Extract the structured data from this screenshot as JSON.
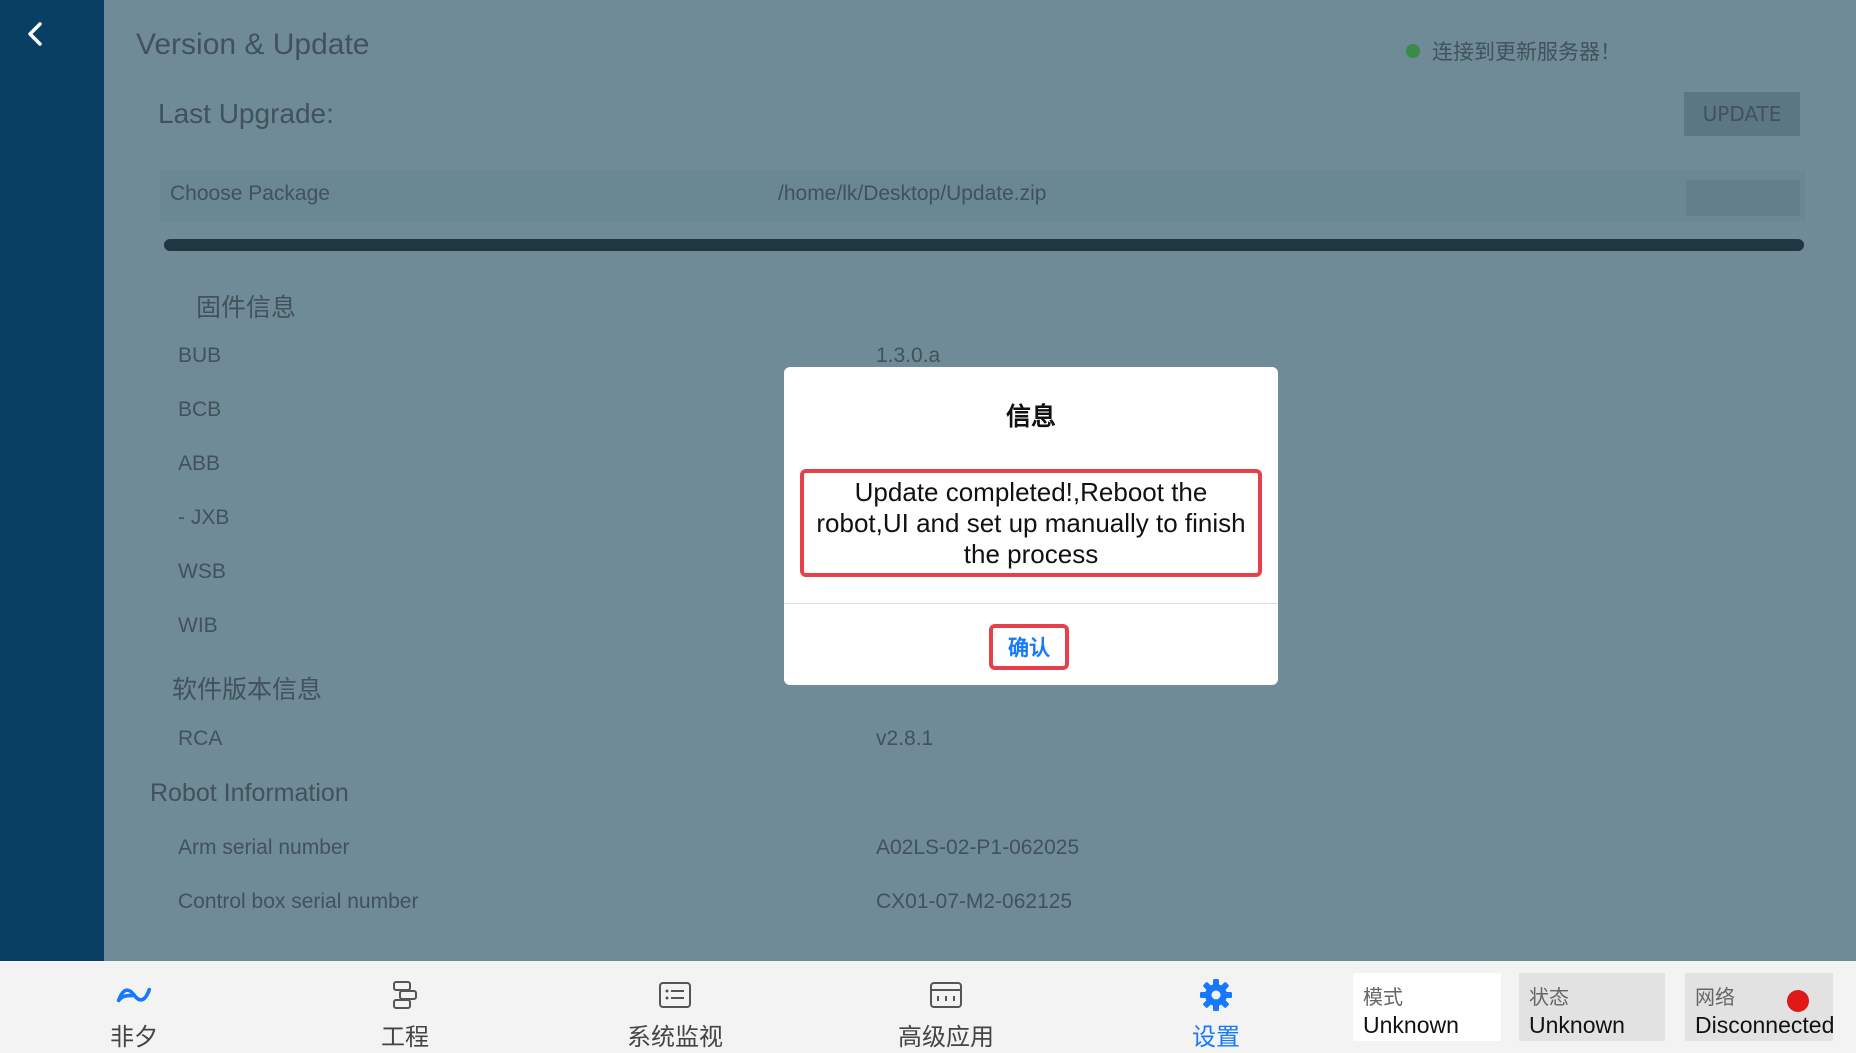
{
  "page": {
    "title": "Version & Update",
    "server_status": "连接到更新服务器！",
    "last_upgrade_label": "Last Upgrade:",
    "top_button_label": "UPDATE",
    "choose_package_label": "Choose Package",
    "package_path": "/home/lk/Desktop/Update.zip"
  },
  "firmware": {
    "section_title": "固件信息",
    "rows": [
      {
        "label": "BUB",
        "value": "1.3.0.a"
      },
      {
        "label": "BCB",
        "value": ""
      },
      {
        "label": "ABB",
        "value": ""
      },
      {
        "label": "- JXB",
        "value": ""
      },
      {
        "label": "WSB",
        "value": ""
      },
      {
        "label": "WIB",
        "value": ""
      }
    ]
  },
  "software": {
    "section_title": "软件版本信息",
    "rows": [
      {
        "label": "RCA",
        "value": "v2.8.1"
      }
    ]
  },
  "robot_info": {
    "section_title": "Robot Information",
    "rows": [
      {
        "label": "Arm serial number",
        "value": "A02LS-02-P1-062025"
      },
      {
        "label": "Control box serial number",
        "value": "CX01-07-M2-062125"
      }
    ]
  },
  "dialog": {
    "title": "信息",
    "message": "Update completed!,Reboot the robot,UI and set up manually to finish the process",
    "confirm_label": "确认"
  },
  "nav": [
    {
      "label": "非夕",
      "icon": "flexiv-logo-icon"
    },
    {
      "label": "工程",
      "icon": "project-icon"
    },
    {
      "label": "系统监视",
      "icon": "monitor-list-icon"
    },
    {
      "label": "高级应用",
      "icon": "advanced-app-icon"
    },
    {
      "label": "设置",
      "icon": "gear-icon",
      "active": true
    }
  ],
  "status": {
    "mode": {
      "title": "模式",
      "value": "Unknown"
    },
    "state": {
      "title": "状态",
      "value": "Unknown"
    },
    "network": {
      "title": "网络",
      "value": "Disconnected",
      "indicator_color": "#e01818"
    }
  },
  "colors": {
    "sidebar": "#083f63",
    "accent": "#1677ff",
    "highlight_border": "#e8404a"
  }
}
